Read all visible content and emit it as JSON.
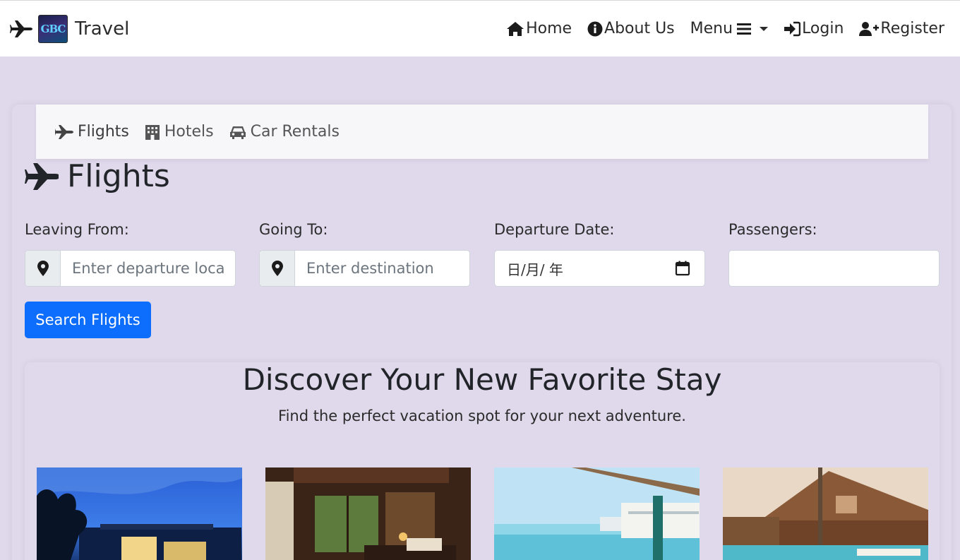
{
  "brand": {
    "logo_text": "GBC",
    "name": "Travel"
  },
  "nav": {
    "home": "Home",
    "about": "About Us",
    "menu": "Menu",
    "login": "Login",
    "register": "Register"
  },
  "tabs": [
    "Flights",
    "Hotels",
    "Car Rentals"
  ],
  "form": {
    "title": "Flights",
    "leaving_label": "Leaving From:",
    "leaving_placeholder": "Enter departure location",
    "going_label": "Going To:",
    "going_placeholder": "Enter destination",
    "date_label": "Departure Date:",
    "date_value": "日/月/ 年",
    "passengers_label": "Passengers:",
    "passengers_value": "",
    "search_button": "Search Flights"
  },
  "discover": {
    "title": "Discover Your New Favorite Stay",
    "subtitle": "Find the perfect vacation spot for your next adventure."
  },
  "colors": {
    "primary": "#0d6efd",
    "background": "#e0d9ec"
  }
}
